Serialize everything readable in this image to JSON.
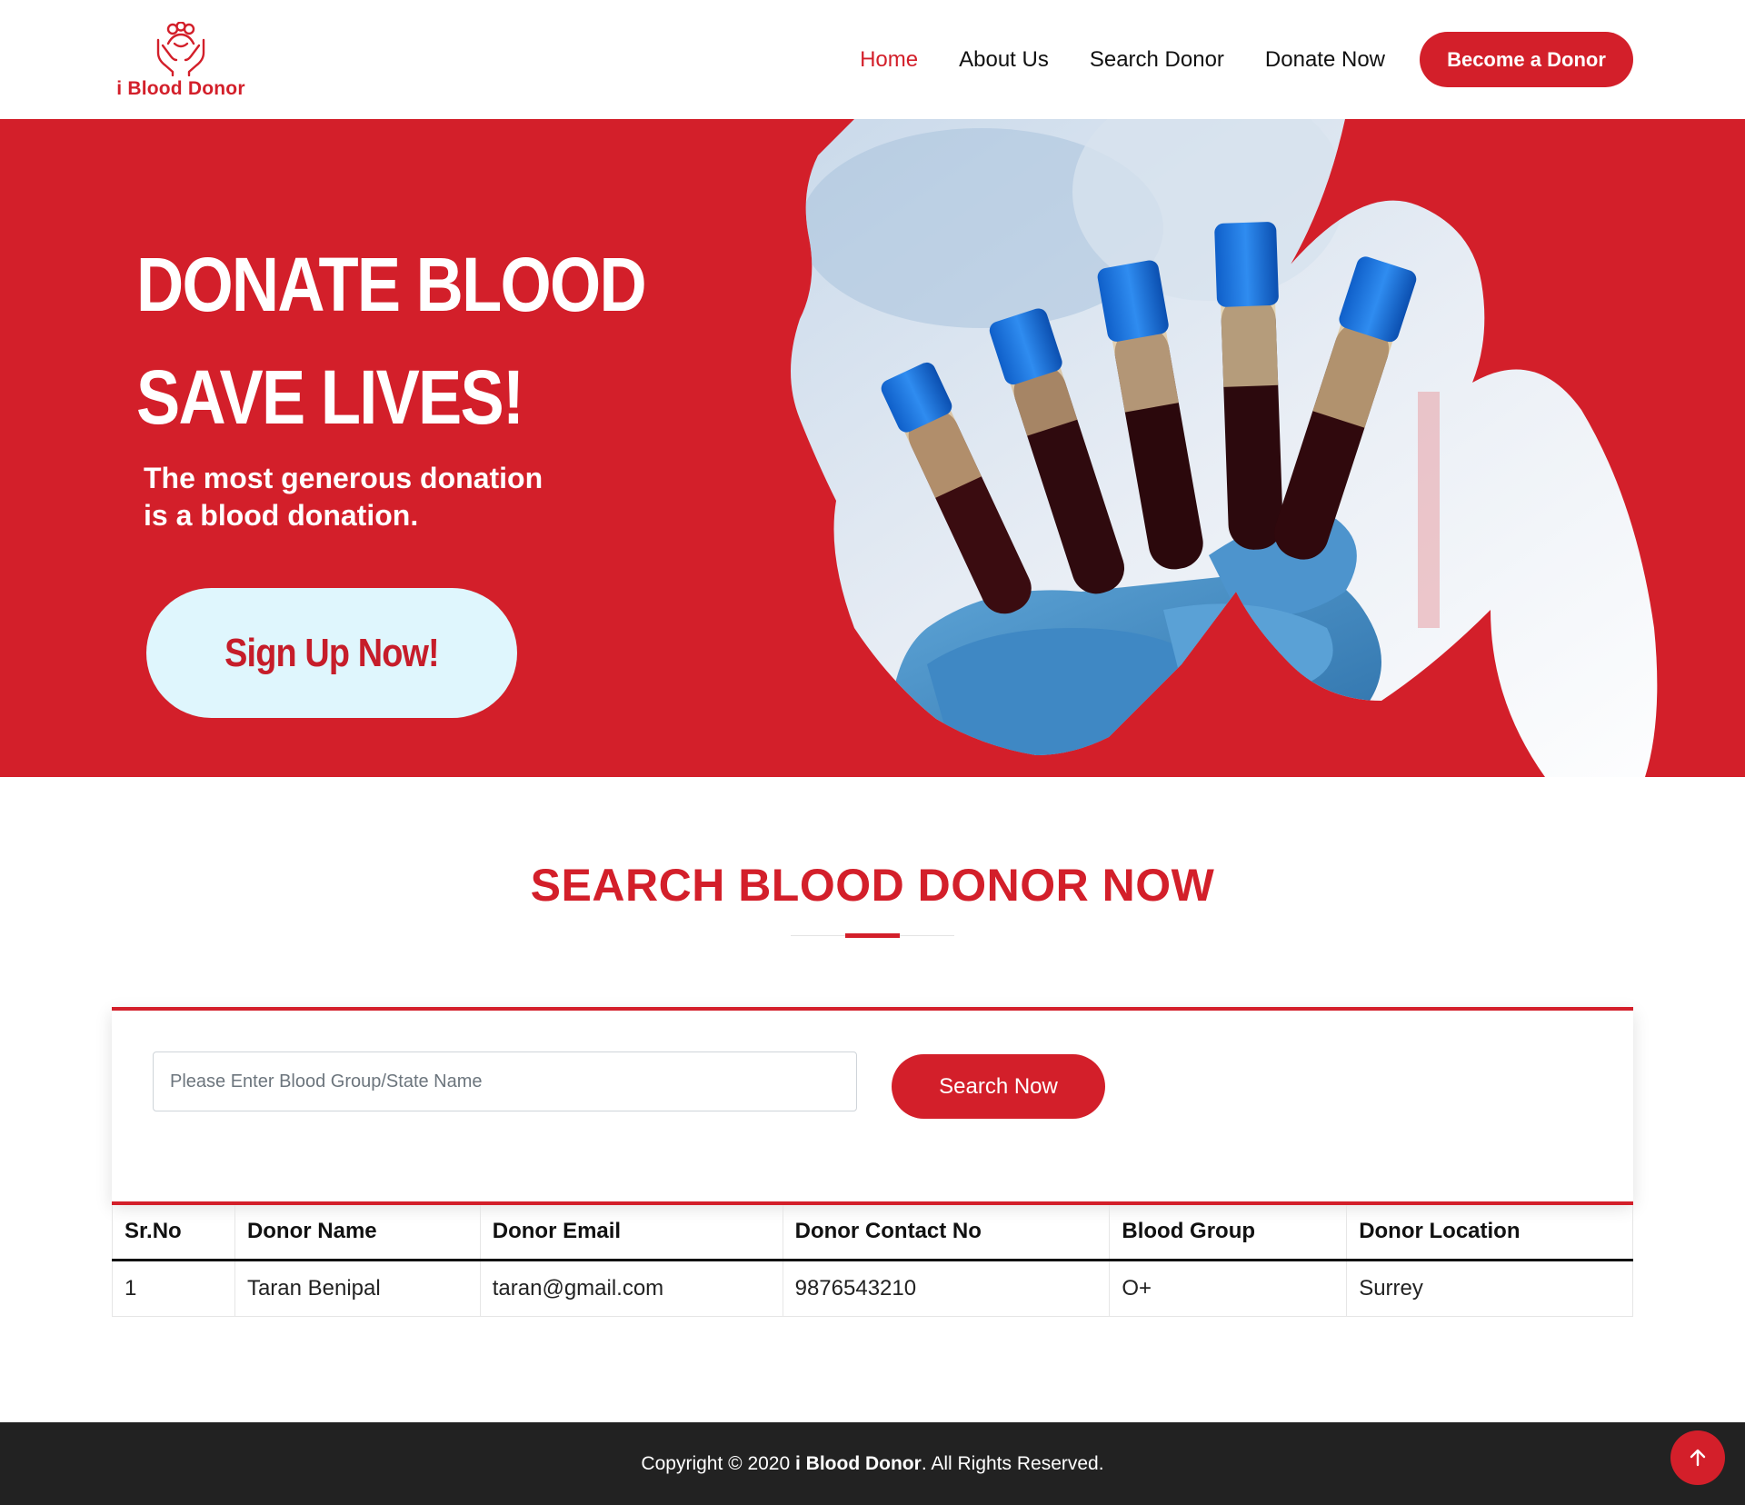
{
  "brand": {
    "name": "i Blood Donor",
    "logo_icon": "hands-people-icon",
    "accent_color": "#d31f2a"
  },
  "nav": {
    "links": [
      {
        "label": "Home",
        "active": true
      },
      {
        "label": "About Us",
        "active": false
      },
      {
        "label": "Search Donor",
        "active": false
      },
      {
        "label": "Donate Now",
        "active": false
      }
    ],
    "cta_label": "Become a Donor"
  },
  "hero": {
    "title_line1": "DONATE BLOOD",
    "title_line2": "SAVE LIVES!",
    "subtitle_line1": "The most generous donation",
    "subtitle_line2": "is a blood donation.",
    "signup_label": "Sign Up Now!",
    "image_subject": "blood-sample-tubes-gloved-hand"
  },
  "search": {
    "heading": "SEARCH BLOOD DONOR NOW",
    "input_placeholder": "Please Enter Blood Group/State Name",
    "input_value": "",
    "button_label": "Search Now"
  },
  "table": {
    "headers": [
      "Sr.No",
      "Donor Name",
      "Donor Email",
      "Donor Contact No",
      "Blood Group",
      "Donor Location"
    ],
    "rows": [
      [
        "1",
        "Taran Benipal",
        "taran@gmail.com",
        "9876543210",
        "O+",
        "Surrey"
      ]
    ]
  },
  "footer": {
    "prefix": "Copyright © 2020 ",
    "brand": "i Blood Donor",
    "suffix": ". All Rights Reserved.",
    "back_to_top_icon": "arrow-up-icon"
  }
}
